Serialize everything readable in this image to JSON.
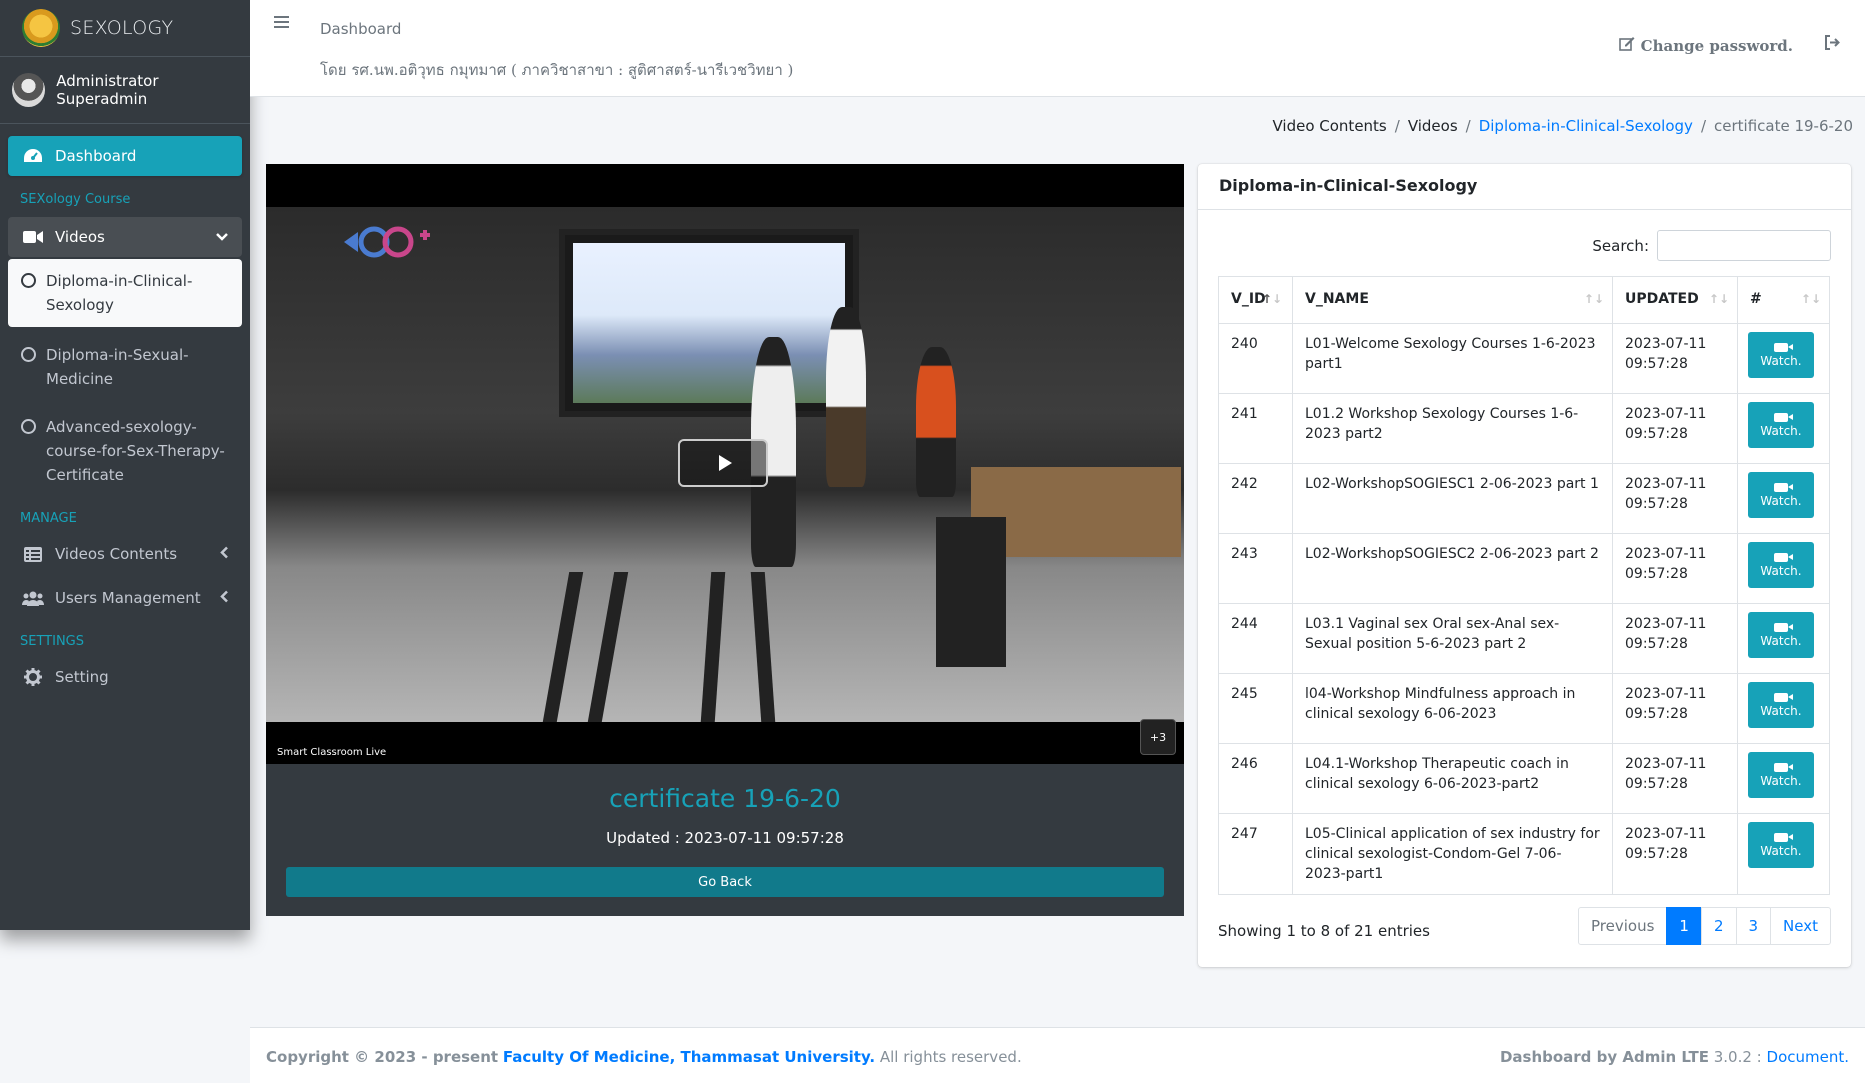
{
  "brand": {
    "name": "SEXOLOGY"
  },
  "user": {
    "name": "Administrator Superadmin"
  },
  "sidebar": {
    "dashboard_label": "Dashboard",
    "section_course": "SEXology Course",
    "videos_label": "Videos",
    "sub_items": [
      "Diploma-in-Clinical-Sexology",
      "Diploma-in-Sexual-Medicine",
      "Advanced-sexology-course-for-Sex-Therapy-Certificate"
    ],
    "section_manage": "MANAGE",
    "videos_contents_label": "Videos Contents",
    "users_management_label": "Users Management",
    "section_settings": "SETTINGS",
    "setting_label": "Setting"
  },
  "header": {
    "title": "Dashboard",
    "subtitle": "โดย รศ.นพ.อติวุทธ กมุทมาศ ( ภาควิชาสาขา : สูติศาสตร์-นารีเวชวิทยา )",
    "change_password": "Change password."
  },
  "breadcrumb": [
    "Video Contents",
    "Videos",
    "Diploma-in-Clinical-Sexology",
    "certificate 19-6-20"
  ],
  "video": {
    "title": "certificate 19-6-20",
    "updated": "Updated : 2023-07-11 09:57:28",
    "go_back": "Go Back",
    "live_badge": "Smart Classroom Live",
    "participants_badge": "+3"
  },
  "table_card": {
    "title": "Diploma-in-Clinical-Sexology",
    "search_label": "Search:",
    "columns": [
      "V_ID",
      "V_NAME",
      "UPDATED",
      "#"
    ],
    "rows": [
      {
        "id": "240",
        "name": "L01-Welcome Sexology Courses 1-6-2023 part1",
        "date": "2023-07-11",
        "time": "09:57:28",
        "action": "Watch."
      },
      {
        "id": "241",
        "name": "L01.2 Workshop Sexology Courses 1-6-2023 part2",
        "date": "2023-07-11",
        "time": "09:57:28",
        "action": "Watch."
      },
      {
        "id": "242",
        "name": "L02-WorkshopSOGIESC1 2-06-2023 part 1",
        "date": "2023-07-11",
        "time": "09:57:28",
        "action": "Watch."
      },
      {
        "id": "243",
        "name": "L02-WorkshopSOGIESC2 2-06-2023 part 2",
        "date": "2023-07-11",
        "time": "09:57:28",
        "action": "Watch."
      },
      {
        "id": "244",
        "name": "L03.1 Vaginal sex Oral sex-Anal sex-Sexual position 5-6-2023 part 2",
        "date": "2023-07-11",
        "time": "09:57:28",
        "action": "Watch."
      },
      {
        "id": "245",
        "name": "l04-Workshop Mindfulness approach in clinical sexology 6-06-2023",
        "date": "2023-07-11",
        "time": "09:57:28",
        "action": "Watch."
      },
      {
        "id": "246",
        "name": "L04.1-Workshop Therapeutic coach in clinical sexology 6-06-2023-part2",
        "date": "2023-07-11",
        "time": "09:57:28",
        "action": "Watch."
      },
      {
        "id": "247",
        "name": "L05-Clinical application of sex industry for clinical sexologist-Condom-Gel 7-06-2023-part1",
        "date": "2023-07-11",
        "time": "09:57:28",
        "action": "Watch."
      }
    ],
    "info": "Showing 1 to 8 of 21 entries",
    "pager": [
      "Previous",
      "1",
      "2",
      "3",
      "Next"
    ]
  },
  "footer": {
    "copyright_prefix": "Copyright © 2023 - present",
    "org": "Faculty Of Medicine, Thammasat University.",
    "rights": "All rights reserved.",
    "credit": "Dashboard by Admin LTE",
    "version": "3.0.2 :",
    "doc_link": "Document."
  },
  "colors": {
    "accent": "#17a2b8",
    "primary": "#007bff",
    "sidebar": "#343a40"
  }
}
